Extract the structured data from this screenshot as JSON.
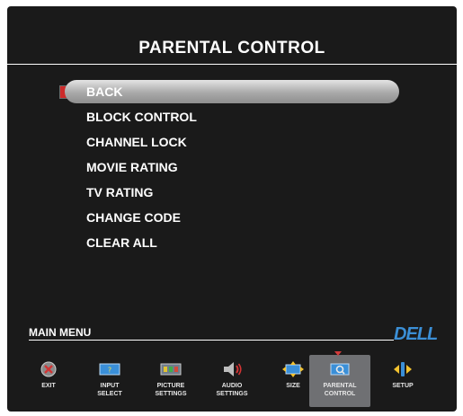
{
  "screen": {
    "title": "PARENTAL CONTROL",
    "menu_items": [
      "BACK",
      "BLOCK CONTROL",
      "CHANNEL LOCK",
      "MOVIE RATING",
      "TV RATING",
      "CHANGE CODE",
      "CLEAR ALL"
    ],
    "selected_index": 0
  },
  "main_menu": {
    "label": "MAIN MENU",
    "brand": "DELL",
    "items": [
      {
        "label": "EXIT",
        "icon": "exit-icon"
      },
      {
        "label": "INPUT SELECT",
        "icon": "input-select-icon"
      },
      {
        "label": "PICTURE SETTINGS",
        "icon": "picture-settings-icon"
      },
      {
        "label": "AUDIO SETTINGS",
        "icon": "audio-settings-icon"
      },
      {
        "label": "SIZE",
        "icon": "size-icon"
      },
      {
        "label": "PARENTAL CONTROL",
        "icon": "parental-control-icon"
      },
      {
        "label": "SETUP",
        "icon": "setup-icon"
      }
    ],
    "active_index": 5
  },
  "colors": {
    "background": "#1a1a1a",
    "highlight": "#a9a9a9",
    "brand": "#3b8fd6",
    "marker": "#cc2a2a"
  }
}
